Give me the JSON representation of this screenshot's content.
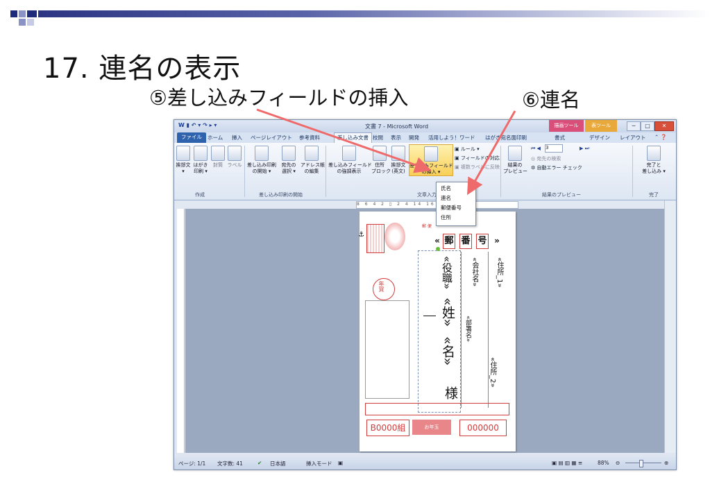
{
  "slide": {
    "title": "17. 連名の表示",
    "callout_insert_field": "⑤差し込みフィールドの挿入",
    "callout_renmei": "⑥連名"
  },
  "window": {
    "title": "文書 7 - Microsoft Word",
    "context_tool_1": "描画ツール",
    "context_tool_2": "表ツール",
    "quick_access": "W ▮ ↶ ▾ ↷ ▸ ▾",
    "window_controls": {
      "minimize": "─",
      "maximize": "□",
      "close": "✕"
    }
  },
  "tabs": [
    {
      "label": "ファイル"
    },
    {
      "label": "ホーム"
    },
    {
      "label": "挿入"
    },
    {
      "label": "ページレイアウト"
    },
    {
      "label": "参考資料"
    },
    {
      "label": "差し込み文書"
    },
    {
      "label": "校閲"
    },
    {
      "label": "表示"
    },
    {
      "label": "開発"
    },
    {
      "label": "活用しよう！ワード"
    },
    {
      "label": "はがき宛名面印刷"
    },
    {
      "label": "書式"
    },
    {
      "label": "デザイン"
    },
    {
      "label": "レイアウト"
    }
  ],
  "ribbon": {
    "create": {
      "label": "作成",
      "greeting": "挨拶文",
      "postcard_1": "はがき",
      "postcard_2": "印刷 ▾",
      "envelope": "封筒",
      "labels": "ラベル"
    },
    "start_merge": {
      "label": "差し込み印刷の開始",
      "start_1": "差し込み印刷",
      "start_2": "の開始 ▾",
      "select_1": "宛先の",
      "select_2": "選択 ▾",
      "edit_1": "アドレス帳",
      "edit_2": "の編集"
    },
    "write_insert": {
      "label": "文章入力と",
      "highlight_1": "差し込みフィールド",
      "highlight_2": "の強調表示",
      "address_block_1": "住所",
      "address_block_2": "ブロック",
      "greeting_line_1": "挨拶文",
      "greeting_line_2": "(英文)",
      "insert_field_1": "差し込みフィールド",
      "insert_field_2": "の挿入 ▾",
      "rules": "ルール ▾",
      "match_fields": "フィールドの対応",
      "update_labels": "複数ラベルに反映"
    },
    "preview": {
      "label": "結果のプレビュー",
      "preview_1": "結果の",
      "preview_2": "プレビュー",
      "record": "3",
      "find": "宛先の検索",
      "check": "自動エラー チェック"
    },
    "finish": {
      "label": "完了",
      "finish_1": "完了と",
      "finish_2": "差し込み ▾"
    }
  },
  "dropdown": {
    "items": [
      {
        "label": "氏名"
      },
      {
        "label": "連名"
      },
      {
        "label": "郵便番号"
      },
      {
        "label": "住所"
      }
    ]
  },
  "ruler": {
    "ticks": "8 6 4 2 ▯ 2 4 14 16"
  },
  "postcard": {
    "stamp_top": "郵 便",
    "zip_open": "«",
    "zip_1": "郵",
    "zip_2": "番",
    "zip_3": "号",
    "zip_close": "»",
    "field_yakushoku": "«役職»",
    "field_sei": "«姓»",
    "field_mei": "«名»",
    "sama": "様",
    "field_company": "«会社名»",
    "field_dept": "«部署名»",
    "field_address1": "«住所_1»",
    "field_address2": "«住所_2»",
    "nenga": "年賀",
    "sender_zip": "B0000組",
    "sender_number": "000000",
    "sender_tag": "お年玉"
  },
  "statusbar": {
    "page": "ページ: 1/1",
    "words": "文字数: 41",
    "language": "日本語",
    "mode": "挿入モード",
    "zoom": "88%"
  },
  "colors": {
    "accent_arrow": "#ef6a6a",
    "file_tab": "#2f62ad",
    "title_bar": "#c9d6ea",
    "postcard_red": "#d23b3b",
    "context_tool_1": "#d94f7a",
    "context_tool_2": "#e9a93a"
  }
}
